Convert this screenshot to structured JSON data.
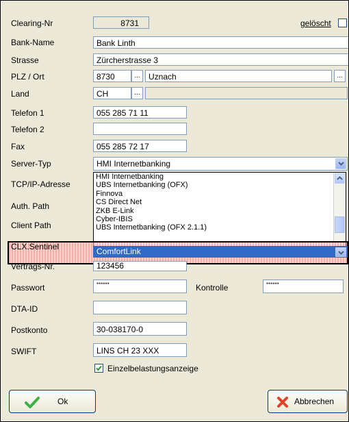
{
  "form": {
    "clearing_label": "Clearing-Nr",
    "clearing_value": "8731",
    "deleted_label": "gelöscht",
    "bank_name_label": "Bank-Name",
    "bank_name_value": "Bank Linth",
    "street_label": "Strasse",
    "street_value": "Zürcherstrasse 3",
    "zip_city_label": "PLZ / Ort",
    "zip_value": "8730",
    "city_value": "Uznach",
    "country_label": "Land",
    "country_value": "CH",
    "dots": "...",
    "phone1_label": "Telefon 1",
    "phone1_value": "055 285 71 11",
    "phone2_label": "Telefon 2",
    "phone2_value": "",
    "fax_label": "Fax",
    "fax_value": "055 285 72 17",
    "server_type_label": "Server-Typ",
    "server_type_value": "HMI Internetbanking",
    "tcpip_label": "TCP/IP-Adresse",
    "auth_path_label": "Auth. Path",
    "client_path_label": "Client Path",
    "clx_label": "CLX.Sentinel",
    "clx_value": "ComfortLink",
    "contract_label": "Vertrags-Nr.",
    "contract_value": "123456",
    "password_label": "Passwort",
    "password_value": "******",
    "control_label": "Kontrolle",
    "control_value": "******",
    "dta_label": "DTA-ID",
    "dta_value": "",
    "postkonto_label": "Postkonto",
    "postkonto_value": "30-038170-0",
    "swift_label": "SWIFT",
    "swift_value": "LINS CH 23 XXX",
    "single_debit_label": "Einzelbelastungsanzeige",
    "single_debit_checked": true
  },
  "dropdown": {
    "items": [
      "HMI Internetbanking",
      "UBS Internetbanking (OFX)",
      "Finnova",
      "CS Direct Net",
      "ZKB E-Link",
      "Cyber-IBIS",
      "UBS Internetbanking (OFX 2.1.1)"
    ]
  },
  "buttons": {
    "ok_label": "Ok",
    "cancel_label": "Abbrechen"
  },
  "colors": {
    "selection": "#316ac5",
    "highlight_border": "#000000",
    "ok_check": "#3cb043",
    "cancel_x": "#e0422b"
  }
}
